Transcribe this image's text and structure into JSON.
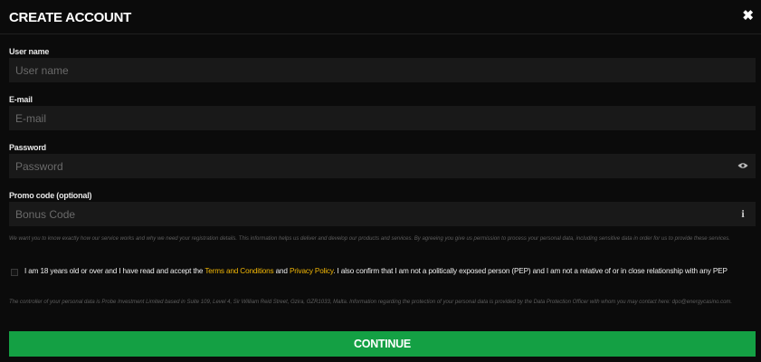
{
  "header": {
    "title": "CREATE ACCOUNT",
    "close_icon": "close-icon"
  },
  "form": {
    "username": {
      "label": "User name",
      "placeholder": "User name",
      "value": ""
    },
    "email": {
      "label": "E-mail",
      "placeholder": "E-mail",
      "value": ""
    },
    "password": {
      "label": "Password",
      "placeholder": "Password",
      "value": "",
      "toggle_icon": "eye-icon"
    },
    "promo": {
      "label": "Promo code (optional)",
      "placeholder": "Bonus Code",
      "value": "",
      "info_icon": "info-icon"
    }
  },
  "notice_text": "We want you to know exactly how our service works and why we need your registration details. This information helps us deliver and develop our products and services. By agreeing you give us permission to process your personal data, including sensitive data in order for us to provide these services.",
  "consent": {
    "checked": false,
    "text_before": "I am 18 years old or over and I have read and accept the ",
    "terms_link": "Terms and Conditions",
    "text_and": " and ",
    "privacy_link": "Privacy Policy",
    "text_after": ". I also confirm that I am not a politically exposed person (PEP) and I am not a relative of or in close relationship with any PEP"
  },
  "controller_text": "The controller of your personal data is Probe Investment Limited based in Suite 109, Level 4, Sir William Reid Street, Gzira, GZR1033, Malta. Information regarding the protection of your personal data is provided by the Data Protection Officer with whom you may contact here: dpo@energycasino.com.",
  "continue_label": "CONTINUE",
  "colors": {
    "background": "#0b0b0b",
    "field": "#191919",
    "link": "#f2b705",
    "button": "#14a044"
  }
}
